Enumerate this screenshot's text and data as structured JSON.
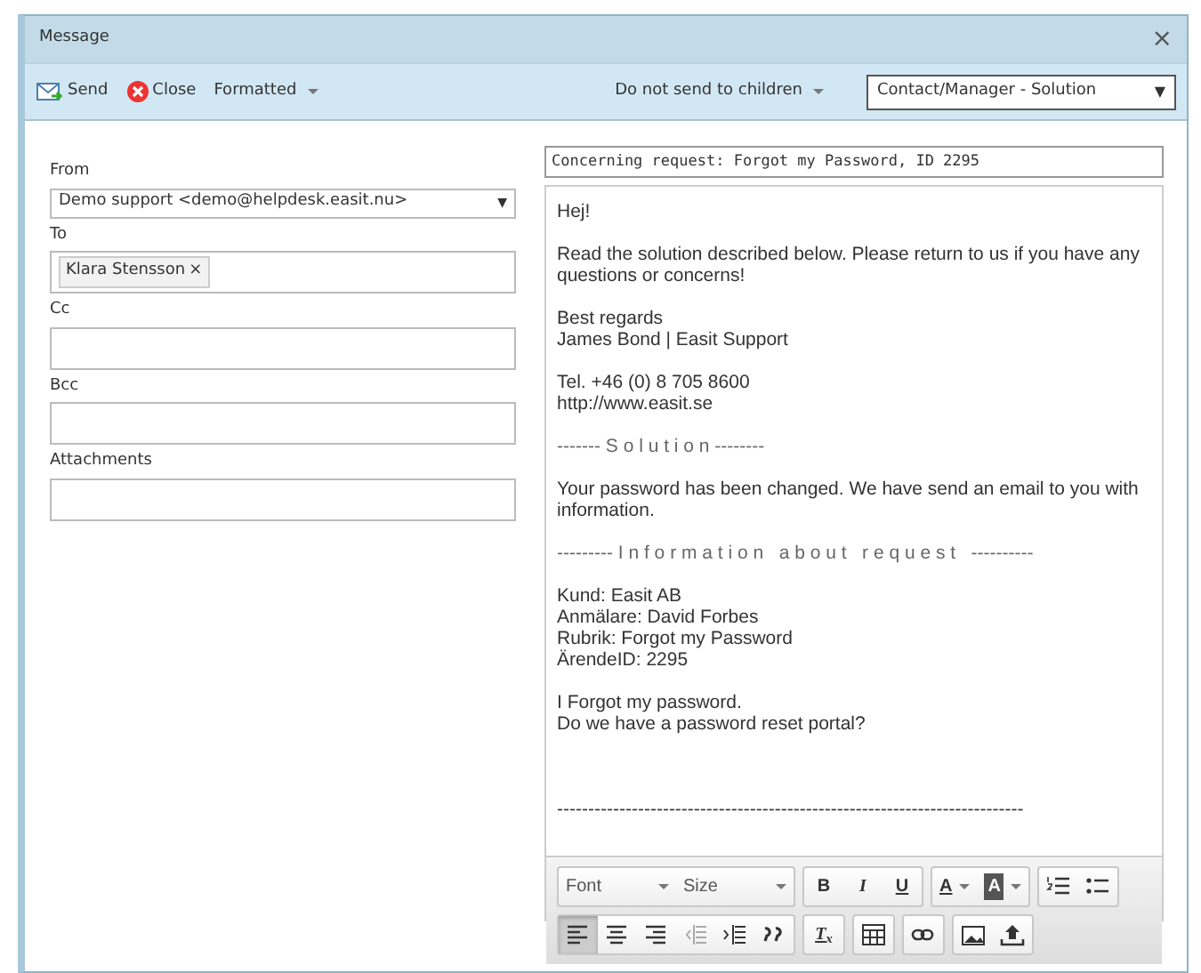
{
  "window": {
    "title": "Message",
    "close": "×"
  },
  "toolbar": {
    "send": "Send",
    "close": "Close",
    "format": "Formatted",
    "children": "Do not send to children",
    "template": "Contact/Manager - Solution",
    "template_arrow": "▼"
  },
  "form": {
    "from": {
      "label": "From",
      "value": "Demo support <demo@helpdesk.easit.nu>",
      "arrow": "▼"
    },
    "to": {
      "label": "To",
      "recipients": [
        {
          "name": "Klara Stensson",
          "remove": "×"
        }
      ]
    },
    "cc": {
      "label": "Cc"
    },
    "bcc": {
      "label": "Bcc"
    },
    "attachments": {
      "label": "Attachments"
    }
  },
  "subject": "Concerning request: Forgot my Password, ID 2295",
  "body": [
    {
      "kind": "text",
      "lines": [
        "Hej!"
      ]
    },
    {
      "kind": "text",
      "lines": [
        "Read the solution described below. Please return to us if you have any questions or concerns!"
      ]
    },
    {
      "kind": "text",
      "lines": [
        "Best regards",
        "James Bond | Easit Support"
      ]
    },
    {
      "kind": "text",
      "lines": [
        "Tel. +46 (0) 8 705 8600",
        "http://www.easit.se"
      ]
    },
    {
      "kind": "heading",
      "lines": [
        "------- S o l u t i o n --------"
      ]
    },
    {
      "kind": "text",
      "lines": [
        "Your password has been changed. We have send an email to you with information."
      ]
    },
    {
      "kind": "heading",
      "lines": [
        "--------- I n f o r m a t i o n   a b o u t   r e q u e s t   ----------"
      ]
    },
    {
      "kind": "text",
      "lines": [
        "Kund: Easit AB",
        "Anmälare: David Forbes",
        "Rubrik: Forgot my Password",
        "ÄrendeID: 2295"
      ]
    },
    {
      "kind": "text",
      "lines": [
        "I Forgot my password.",
        "Do we have a password reset portal?"
      ]
    },
    {
      "kind": "blank"
    },
    {
      "kind": "text",
      "lines": [
        "---------------------------------------------------------------------------"
      ]
    }
  ],
  "editor_toolbar": [
    [
      [
        {
          "kind": "dropdown",
          "label": "Font",
          "selected": false
        },
        {
          "kind": "dropdown",
          "label": "Size",
          "selected": false
        }
      ],
      [
        {
          "kind": "bold",
          "label": "B",
          "selected": false
        },
        {
          "kind": "italic",
          "label": "I",
          "selected": false
        },
        {
          "kind": "underline",
          "label": "U",
          "selected": false
        }
      ],
      [
        {
          "kind": "textcolor",
          "label": "A",
          "selected": false
        },
        {
          "kind": "bgcolor",
          "label": "A",
          "selected": false
        }
      ],
      [
        {
          "kind": "numbered",
          "selected": false
        },
        {
          "kind": "bulleted",
          "selected": false
        }
      ]
    ],
    [
      [
        {
          "kind": "alignleft",
          "selected": true
        },
        {
          "kind": "aligncenter",
          "selected": false
        },
        {
          "kind": "alignright",
          "selected": false
        },
        {
          "kind": "outdent",
          "selected": false
        },
        {
          "kind": "indent",
          "selected": false
        },
        {
          "kind": "quote",
          "selected": false
        }
      ],
      [
        {
          "kind": "clearformat",
          "label": "T$_{x}$",
          "selected": false
        }
      ],
      [
        {
          "kind": "table",
          "selected": false
        }
      ],
      [
        {
          "kind": "link",
          "selected": false
        }
      ],
      [
        {
          "kind": "image",
          "selected": false
        },
        {
          "kind": "upload",
          "selected": false
        }
      ]
    ]
  ]
}
